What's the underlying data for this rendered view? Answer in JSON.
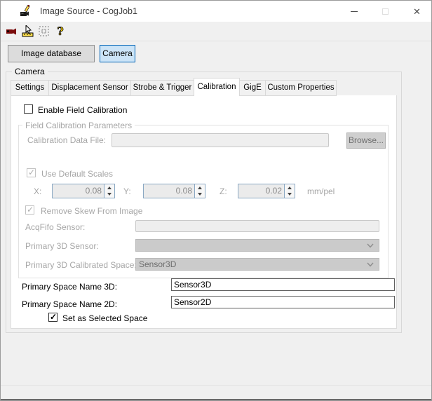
{
  "window": {
    "title": "Image Source - CogJob1",
    "controls": [
      "minimize",
      "maximize-disabled",
      "close"
    ]
  },
  "toolbar": {
    "icons": [
      "camera-icon",
      "calibration-ruler-icon",
      "region-icon-disabled",
      "help-icon"
    ]
  },
  "source_buttons": {
    "image_database": "Image database",
    "camera": "Camera"
  },
  "camera_group": {
    "label": "Camera"
  },
  "tabs": [
    "Settings",
    "Displacement Sensor",
    "Strobe & Trigger",
    "Calibration",
    "GigE",
    "Custom Properties"
  ],
  "active_tab": "Calibration",
  "calibration": {
    "enable_field_calibration": {
      "label": "Enable Field Calibration",
      "checked": false
    },
    "field_group": {
      "label": "Field Calibration Parameters",
      "enabled": false,
      "calibration_data_file": {
        "label": "Calibration Data File:",
        "value": "",
        "browse_label": "Browse..."
      },
      "use_default_scales": {
        "label": "Use Default Scales",
        "checked": true
      },
      "scales": {
        "x_label": "X:",
        "x": "0.08",
        "y_label": "Y:",
        "y": "0.08",
        "z_label": "Z:",
        "z": "0.02",
        "units": "mm/pel"
      },
      "remove_skew": {
        "label": "Remove Skew From Image",
        "checked": true
      },
      "acqfifo_sensor": {
        "label": "AcqFifo Sensor:",
        "value": ""
      },
      "primary_3d_sensor": {
        "label": "Primary 3D Sensor:",
        "value": ""
      },
      "primary_3d_calibrated_space": {
        "label": "Primary 3D Calibrated Space:",
        "value": "Sensor3D"
      }
    },
    "primary_space_name_3d": {
      "label": "Primary Space Name 3D:",
      "value": "Sensor3D"
    },
    "primary_space_name_2d": {
      "label": "Primary Space Name 2D:",
      "value": "Sensor2D"
    },
    "set_as_selected_space": {
      "label": "Set as Selected Space",
      "checked": true
    }
  },
  "colors": {
    "accent": "#0078d4",
    "selected_button_bg": "#cce4f7",
    "dialog_bg": "#f0f0f0",
    "disabled_text": "#a6a6a6"
  }
}
